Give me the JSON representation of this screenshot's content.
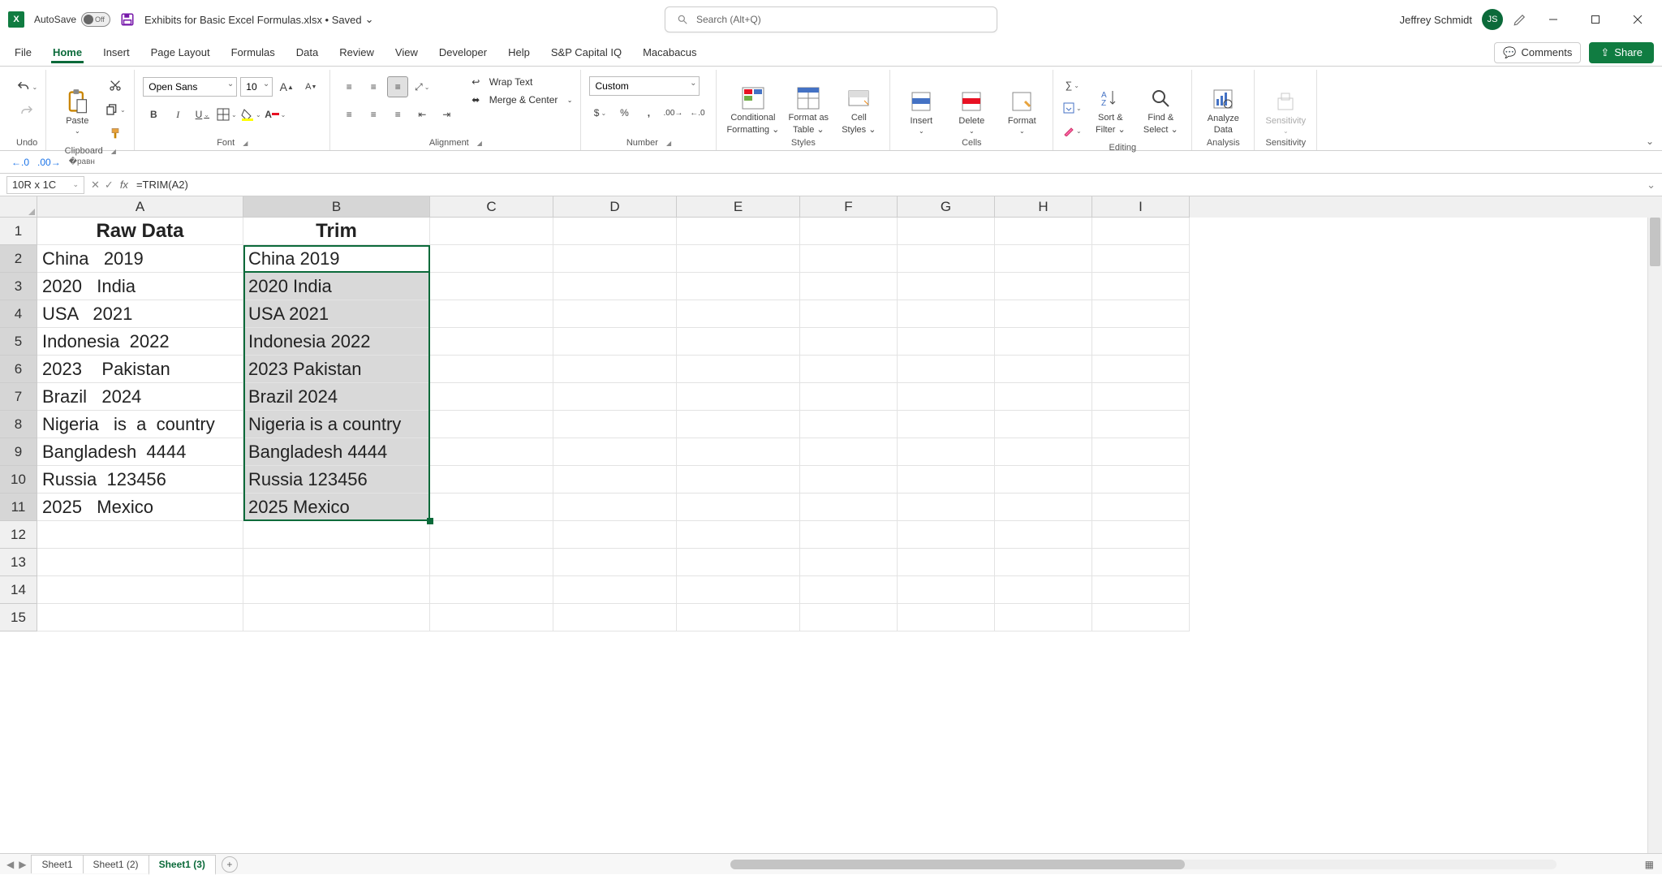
{
  "titlebar": {
    "autosave_label": "AutoSave",
    "autosave_state": "Off",
    "file_title": "Exhibits for Basic Excel Formulas.xlsx • Saved",
    "search_placeholder": "Search (Alt+Q)",
    "user_name": "Jeffrey Schmidt",
    "user_initials": "JS"
  },
  "menu": {
    "tabs": [
      "File",
      "Home",
      "Insert",
      "Page Layout",
      "Formulas",
      "Data",
      "Review",
      "View",
      "Developer",
      "Help",
      "S&P Capital IQ",
      "Macabacus"
    ],
    "active": "Home",
    "comments": "Comments",
    "share": "Share"
  },
  "ribbon": {
    "undo": "Undo",
    "clipboard": "Clipboard",
    "paste": "Paste",
    "font_group": "Font",
    "font_name": "Open Sans",
    "font_size": "10",
    "alignment": "Alignment",
    "wrap": "Wrap Text",
    "merge": "Merge & Center",
    "number": "Number",
    "number_format": "Custom",
    "styles": "Styles",
    "cond_fmt_l1": "Conditional",
    "cond_fmt_l2": "Formatting",
    "fmt_table_l1": "Format as",
    "fmt_table_l2": "Table",
    "cell_styles_l1": "Cell",
    "cell_styles_l2": "Styles",
    "cells": "Cells",
    "insert": "Insert",
    "delete": "Delete",
    "format": "Format",
    "editing": "Editing",
    "sort_l1": "Sort &",
    "sort_l2": "Filter",
    "find_l1": "Find &",
    "find_l2": "Select",
    "analysis": "Analysis",
    "analyze_l1": "Analyze",
    "analyze_l2": "Data",
    "sensitivity": "Sensitivity",
    "sensitivity_btn": "Sensitivity"
  },
  "namebox": "10R x 1C",
  "formula": "=TRIM(A2)",
  "columns": [
    "A",
    "B",
    "C",
    "D",
    "E",
    "F",
    "G",
    "H",
    "I"
  ],
  "grid": {
    "headers": {
      "A": "Raw Data",
      "B": "Trim"
    },
    "rows": [
      {
        "A": "China   2019",
        "B": "China 2019"
      },
      {
        "A": "2020   India",
        "B": "2020 India"
      },
      {
        "A": "USA   2021",
        "B": "USA 2021"
      },
      {
        "A": "Indonesia  2022",
        "B": "Indonesia 2022"
      },
      {
        "A": "2023    Pakistan",
        "B": "2023 Pakistan"
      },
      {
        "A": "Brazil   2024",
        "B": "Brazil 2024"
      },
      {
        "A": "Nigeria   is  a  country",
        "B": "Nigeria is a country"
      },
      {
        "A": "Bangladesh  4444",
        "B": "Bangladesh 4444"
      },
      {
        "A": "Russia  123456",
        "B": "Russia 123456"
      },
      {
        "A": "2025   Mexico",
        "B": "2025 Mexico"
      }
    ],
    "blank_rows": 4
  },
  "sheets": {
    "tabs": [
      "Sheet1",
      "Sheet1 (2)",
      "Sheet1 (3)"
    ],
    "active": "Sheet1 (3)"
  },
  "selection": {
    "range": "B2:B11",
    "active": "B2"
  }
}
